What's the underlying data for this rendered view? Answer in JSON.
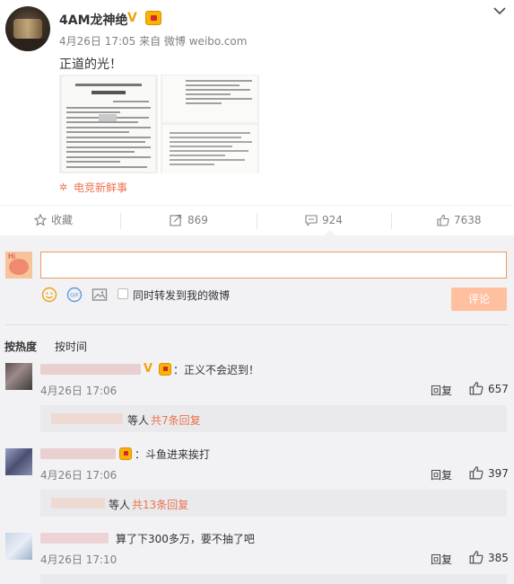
{
  "post": {
    "username": "4AM龙神绝",
    "meta": "4月26日 17:05 来自 微博 weibo.com",
    "text": "正道的光！",
    "topic": "电竞新鲜事",
    "verified_icon": "vip-v-icon",
    "badge_icon": "medal-icon"
  },
  "actions": {
    "favorite": "收藏",
    "reposts": "869",
    "comments": "924",
    "likes": "7638"
  },
  "composer": {
    "input_value": "",
    "repost_label": "同时转发到我的微博",
    "submit": "评论"
  },
  "sort": {
    "hot": "按热度",
    "time": "按时间"
  },
  "comments": [
    {
      "text": "：正义不会迟到！",
      "time": "4月26日 17:06",
      "reply": "回复",
      "likes": "657",
      "sub_suffix": "等人",
      "sub_link": "共7条回复"
    },
    {
      "text": "：斗鱼进来挨打",
      "time": "4月26日 17:06",
      "reply": "回复",
      "likes": "397",
      "sub_suffix": "等人",
      "sub_link": "共13条回复"
    },
    {
      "text": "算了下300多万，要不抽了吧",
      "time": "4月26日 17:10",
      "reply": "回复",
      "likes": "385"
    }
  ],
  "colors": {
    "accent": "#eb7350",
    "submit_bg": "#ffc09f",
    "panel_bg": "#f2f2f5",
    "subbox_bg": "#eaeaec"
  }
}
